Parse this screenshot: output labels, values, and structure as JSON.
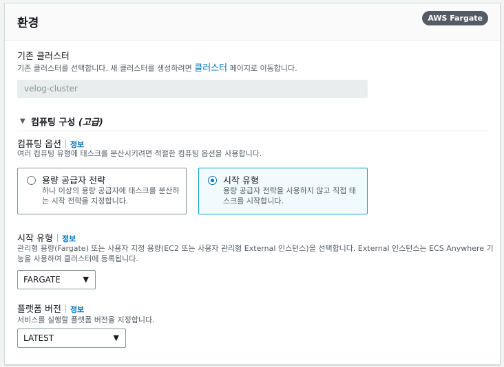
{
  "panel": {
    "title": "환경",
    "badge": "AWS Fargate"
  },
  "existing_cluster": {
    "label": "기존 클러스터",
    "desc_before": "기존 클러스터를 선택합니다. 새 클러스터를 생성하려면 ",
    "desc_link": "클러스터",
    "desc_after": " 페이지로 이동합니다.",
    "value": "velog-cluster"
  },
  "compute_config": {
    "title": "컴퓨팅 구성 ",
    "title_suffix": "(고급)"
  },
  "compute_options": {
    "label": "컴퓨팅 옵션",
    "info": "정보",
    "desc": "여러 컴퓨팅 유형에 태스크를 분산시키려면 적절한 컴퓨팅 옵션을 사용합니다.",
    "tiles": [
      {
        "title": "용량 공급자 전략",
        "desc": "하나 이상의 용량 공급자에 태스크를 분산하는 시작 전략을 지정합니다.",
        "selected": false
      },
      {
        "title": "시작 유형",
        "desc": "용량 공급자 전략을 사용하지 않고 직접 태스크를 시작합니다.",
        "selected": true
      }
    ]
  },
  "launch_type": {
    "label": "시작 유형",
    "info": "정보",
    "desc_line1": "관리형 용량(Fargate) 또는 사용자 지정 용량(EC2 또는 사용자 관리형 External 인스턴스)을 선택합니다. External 인스턴스는 ECS Anywhere 기",
    "desc_line2": "능을 사용하여 클러스터에 등록됩니다.",
    "value": "FARGATE"
  },
  "platform_version": {
    "label": "플랫폼 버전",
    "info": "정보",
    "desc": "서비스를 실행할 플랫폼 버전을 지정합니다.",
    "value": "LATEST"
  },
  "icons": {
    "caret": "caret-down-icon",
    "select_arrow": "dropdown-arrow-icon"
  }
}
